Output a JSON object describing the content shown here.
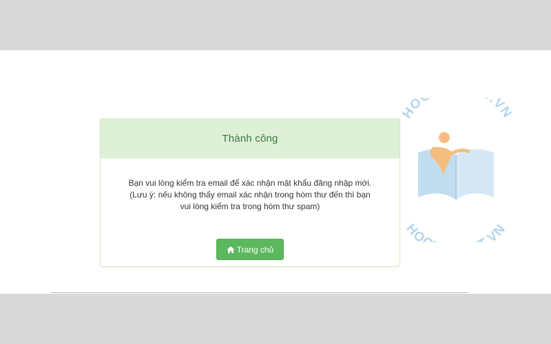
{
  "card": {
    "title": "Thành công",
    "message": "Bạn vui lòng kiểm tra email để xác nhận mật khẩu đăng nhập mới. (Lưu ý: nếu không thấy email xác nhận trong hòm thư đến thì bạn vui lòng kiểm tra trong hòm thư spam)",
    "home_button_label": "Trang chủ"
  },
  "icons": {
    "home": "home-icon"
  },
  "watermark": {
    "text_top": "HOCTOT.NET.VN",
    "text_bottom": "HOCTOT.NET.VN"
  },
  "colors": {
    "success_header_bg": "#dff0d8",
    "success_title": "#3c763d",
    "button_green": "#5cb85c",
    "background_band": "#d9d9d9",
    "watermark_blue": "#a9cde8",
    "watermark_orange": "#f5b26b"
  }
}
